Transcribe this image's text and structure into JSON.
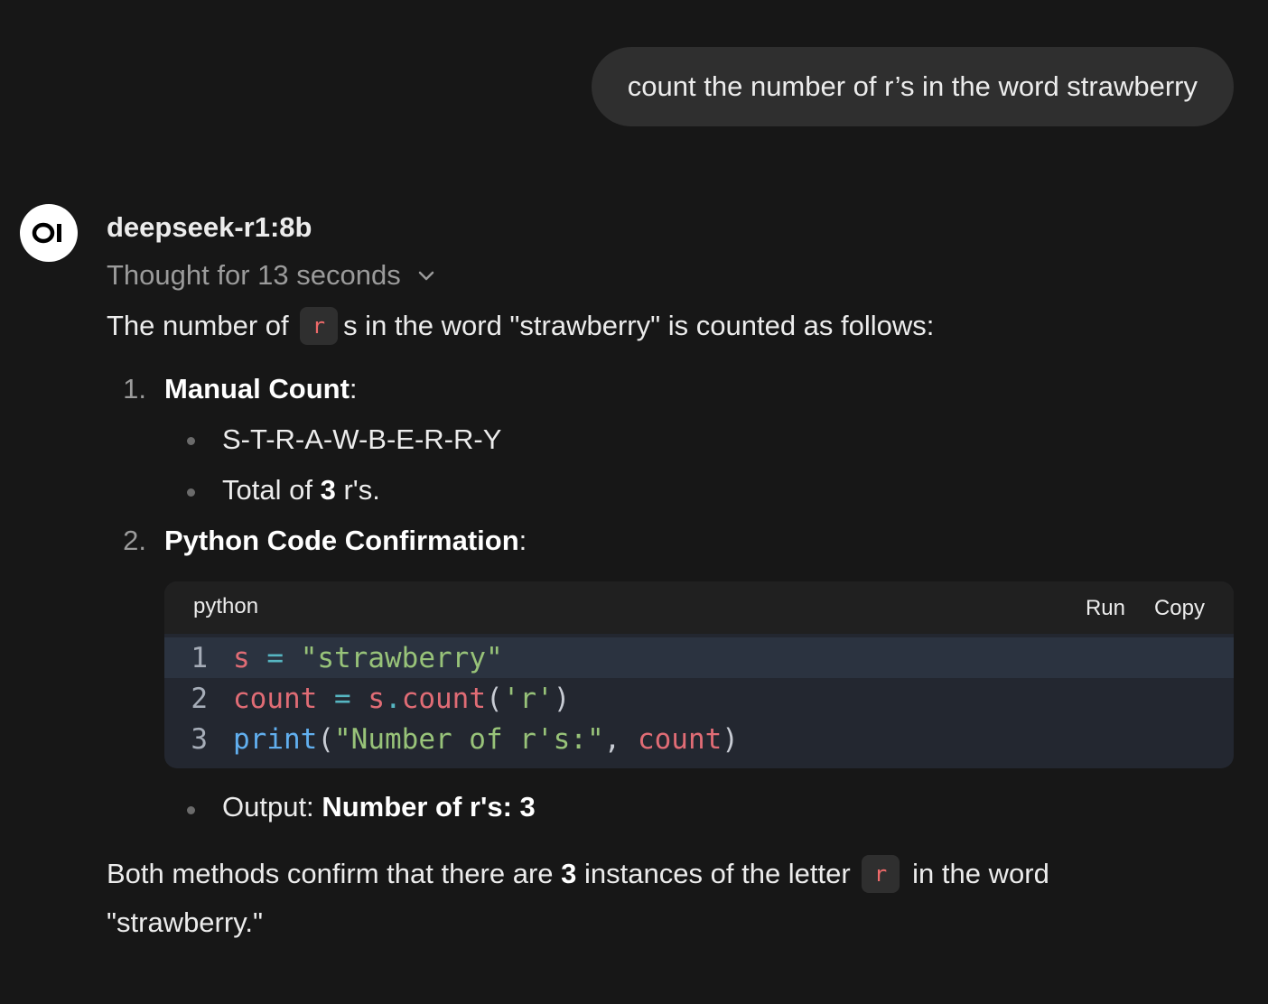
{
  "user_message": "count the number of r’s in the word strawberry",
  "assistant": {
    "model_name": "deepseek-r1:8b",
    "thought_label": "Thought for 13 seconds",
    "intro_before": "The number of",
    "intro_code": "r",
    "intro_after": "s in the word \"strawberry\" is counted as follows:",
    "list": [
      {
        "number": "1.",
        "title": "Manual Count",
        "colon": ":",
        "bullets": [
          "S-T-R-A-W-B-E-R-R-Y",
          {
            "before": "Total of",
            "bold": "3",
            "after": "r's."
          }
        ]
      },
      {
        "number": "2.",
        "title": "Python Code Confirmation",
        "colon": ":"
      }
    ],
    "code_block": {
      "language": "python",
      "run_label": "Run",
      "copy_label": "Copy",
      "line_numbers": [
        "1",
        "2",
        "3"
      ],
      "lines": [
        "s = \"strawberry\"",
        "count = s.count('r')",
        "print(\"Number of r's:\", count)"
      ]
    },
    "output_label": "Output:",
    "output_value": "Number of r's: 3",
    "conclusion_before": "Both methods confirm that there are",
    "conclusion_bold": "3",
    "conclusion_mid": "instances of the letter",
    "conclusion_code": "r",
    "conclusion_after": "in the word",
    "conclusion_line2": "\"strawberry.\""
  },
  "colors": {
    "background": "#171717",
    "bubble": "#2f2f2f",
    "inline_code_text": "#ef6a6a",
    "code_bg": "#232730"
  },
  "icons": [
    "openwebui-logo",
    "chevron-down-icon"
  ]
}
